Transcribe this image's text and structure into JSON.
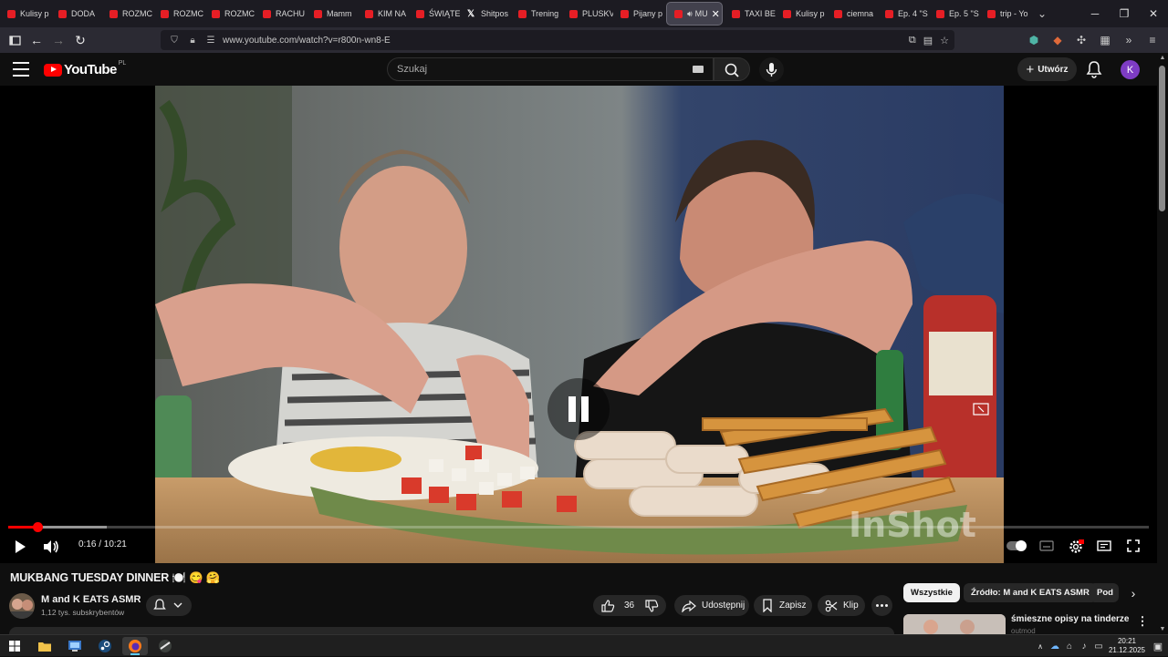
{
  "browser": {
    "tabs": [
      {
        "label": "Kulisy p",
        "favicon": "youtube-icon"
      },
      {
        "label": "DODA",
        "favicon": "youtube-icon"
      },
      {
        "label": "ROZMC",
        "favicon": "youtube-icon"
      },
      {
        "label": "ROZMC",
        "favicon": "youtube-icon"
      },
      {
        "label": "ROZMC",
        "favicon": "youtube-icon"
      },
      {
        "label": "RACHU",
        "favicon": "youtube-icon"
      },
      {
        "label": "Mamm",
        "favicon": "youtube-icon"
      },
      {
        "label": "KIM NA",
        "favicon": "youtube-icon"
      },
      {
        "label": "ŚWIĄTE",
        "favicon": "youtube-icon"
      },
      {
        "label": "Shitpos",
        "favicon": "x-icon"
      },
      {
        "label": "Trening",
        "favicon": "youtube-icon"
      },
      {
        "label": "PLUSKV",
        "favicon": "youtube-icon"
      },
      {
        "label": "Pijany p",
        "favicon": "youtube-icon"
      },
      {
        "label": "MU",
        "favicon": "youtube-icon",
        "active": true
      },
      {
        "label": "TAXI BE",
        "favicon": "youtube-icon"
      },
      {
        "label": "Kulisy p",
        "favicon": "youtube-icon"
      },
      {
        "label": "ciemna",
        "favicon": "youtube-icon"
      },
      {
        "label": "Ep. 4 \"S",
        "favicon": "youtube-icon"
      },
      {
        "label": "Ep. 5 \"S",
        "favicon": "youtube-icon"
      },
      {
        "label": "trip - Yo",
        "favicon": "youtube-icon"
      }
    ],
    "url": "www.youtube.com/watch?v=r800n-wn8-E"
  },
  "youtube": {
    "logo_text": "YouTube",
    "logo_region": "PL",
    "search_placeholder": "Szukaj",
    "create_label": "Utwórz",
    "avatar_letter": "K",
    "accent": "#ff0000"
  },
  "player": {
    "current_time": "0:16",
    "duration": "10:21",
    "time_display": "0:16 / 10:21",
    "played_fraction": 0.026,
    "loaded_fraction": 0.086,
    "watermark": "InShot"
  },
  "video": {
    "title": "MUKBANG TUESDAY DINNER 🍽️ 😋 🤗",
    "channel": "M and K EATS ASMR",
    "subscribers": "1,12 tys. subskrybentów",
    "likes": "36",
    "share_label": "Udostępnij",
    "save_label": "Zapisz",
    "clip_label": "Klip"
  },
  "chips": [
    "Wszystkie",
    "Źródło: M and K EATS ASMR",
    "Pod"
  ],
  "related": {
    "title": "śmieszne opisy na tinderze",
    "subtitle": "outmod"
  },
  "taskbar": {
    "time": "20:21",
    "date": "21.12.2025"
  }
}
